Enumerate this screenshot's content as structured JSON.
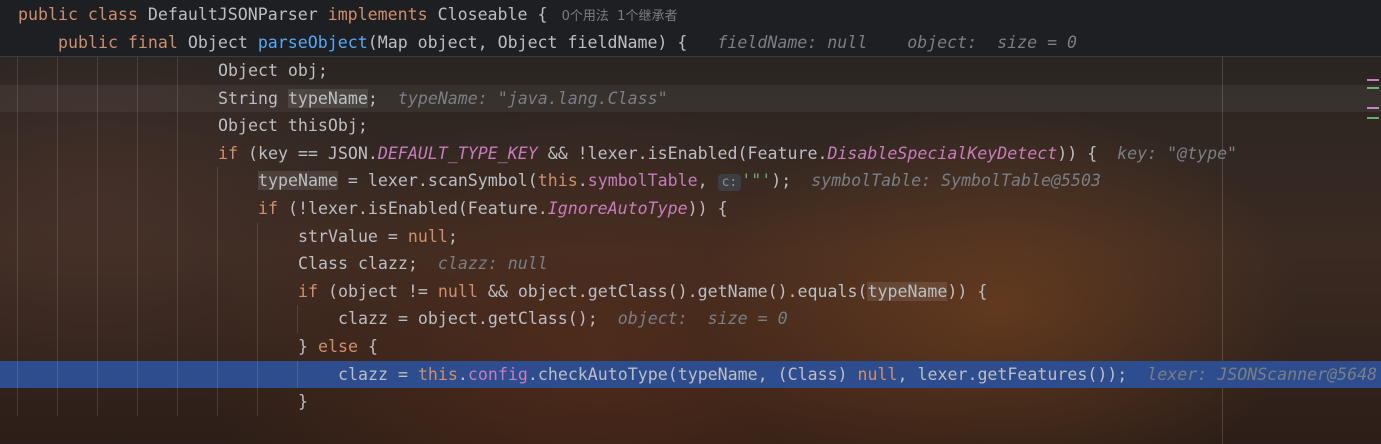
{
  "header": [
    {
      "tokens": [
        [
          "kw",
          "public class "
        ],
        [
          "t",
          "DefaultJSONParser "
        ],
        [
          "kw",
          "implements "
        ],
        [
          "t",
          "Closeable { "
        ],
        [
          "cn",
          " 0个用法  1个继承者"
        ]
      ]
    },
    {
      "tokens": [
        [
          "kw",
          "public final "
        ],
        [
          "t",
          "Object "
        ],
        [
          "fn",
          "parseObject"
        ],
        [
          "t",
          "(Map object, Object fieldName) { "
        ],
        [
          "hint",
          "  fieldName: null    object:  size = 0"
        ]
      ]
    }
  ],
  "lines": [
    {
      "indent": 5,
      "tokens": [
        [
          "t",
          "Object obj;"
        ]
      ]
    },
    {
      "indent": 5,
      "state": "cur",
      "tokens": [
        [
          "t",
          "String "
        ],
        [
          "hl",
          "typeName"
        ],
        [
          "t",
          ";"
        ],
        [
          "hint",
          "  typeName: \"java.lang.Class\""
        ]
      ]
    },
    {
      "indent": 5,
      "tokens": [
        [
          "t",
          "Object thisObj;"
        ]
      ]
    },
    {
      "indent": 5,
      "tokens": [
        [
          "kw",
          "if "
        ],
        [
          "t",
          "(key == JSON."
        ],
        [
          "st",
          "DEFAULT_TYPE_KEY"
        ],
        [
          "t",
          " && !lexer.isEnabled(Feature."
        ],
        [
          "st",
          "DisableSpecialKeyDetect"
        ],
        [
          "t",
          ")) {"
        ],
        [
          "hint",
          "  key: \"@type\""
        ]
      ]
    },
    {
      "indent": 6,
      "tokens": [
        [
          "hl",
          "typeName"
        ],
        [
          "t",
          " = lexer.scanSymbol("
        ],
        [
          "kw",
          "this"
        ],
        [
          "t",
          "."
        ],
        [
          "fld",
          "symbolTable"
        ],
        [
          "t",
          ", "
        ],
        [
          "pbadge",
          "c:"
        ],
        [
          "str",
          "'\"'"
        ],
        [
          "t",
          ");"
        ],
        [
          "hint",
          "  symbolTable: SymbolTable@5503"
        ]
      ]
    },
    {
      "indent": 6,
      "tokens": [
        [
          "kw",
          "if "
        ],
        [
          "t",
          "(!lexer.isEnabled(Feature."
        ],
        [
          "st",
          "IgnoreAutoType"
        ],
        [
          "t",
          ")) {"
        ]
      ]
    },
    {
      "indent": 7,
      "tokens": [
        [
          "t",
          "strValue = "
        ],
        [
          "kw",
          "null"
        ],
        [
          "t",
          ";"
        ]
      ]
    },
    {
      "indent": 7,
      "tokens": [
        [
          "t",
          "Class clazz;"
        ],
        [
          "hint",
          "  clazz: null"
        ]
      ]
    },
    {
      "indent": 7,
      "tokens": [
        [
          "kw",
          "if "
        ],
        [
          "t",
          "(object != "
        ],
        [
          "kw",
          "null"
        ],
        [
          "t",
          " && object.getClass().getName().equals("
        ],
        [
          "hl",
          "typeName"
        ],
        [
          "t",
          ")) {"
        ]
      ]
    },
    {
      "indent": 8,
      "tokens": [
        [
          "t",
          "clazz = object.getClass();"
        ],
        [
          "hint",
          "  object:  size = 0"
        ]
      ]
    },
    {
      "indent": 7,
      "tokens": [
        [
          "t",
          "} "
        ],
        [
          "kw",
          "else"
        ],
        [
          "t",
          " {"
        ]
      ]
    },
    {
      "indent": 8,
      "state": "exec",
      "tokens": [
        [
          "t",
          "clazz = "
        ],
        [
          "kw",
          "this"
        ],
        [
          "t",
          "."
        ],
        [
          "fld",
          "config"
        ],
        [
          "t",
          ".checkAutoType(typeName, (Class) "
        ],
        [
          "kw",
          "null"
        ],
        [
          "t",
          ", lexer.getFeatures());"
        ],
        [
          "hint",
          "  lexer: JSONScanner@5648"
        ]
      ]
    },
    {
      "indent": 7,
      "tokens": [
        [
          "t",
          "}"
        ]
      ]
    }
  ],
  "colors": {
    "keyword": "#cf8e6d",
    "method": "#56a8f5",
    "field": "#c77dbb",
    "hint": "#7a7e85",
    "exec_line": "#2d4d8e"
  }
}
